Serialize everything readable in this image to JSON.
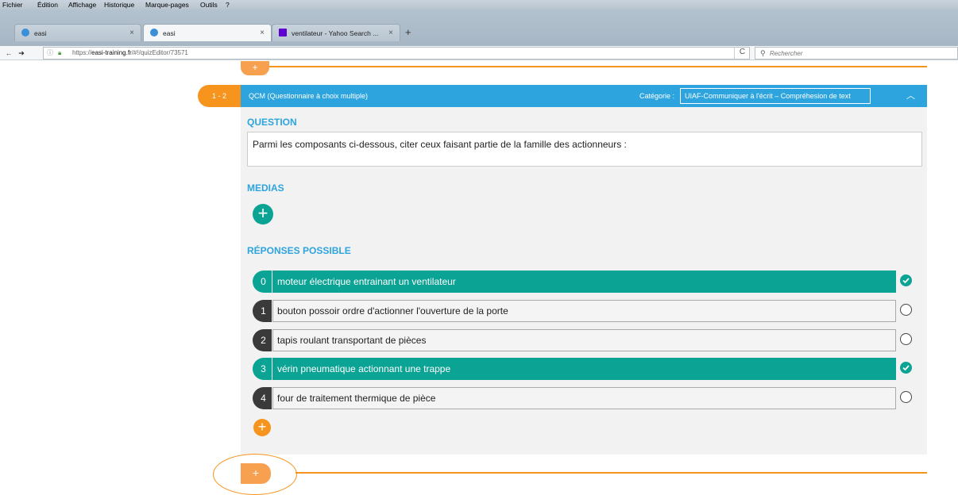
{
  "browser": {
    "menu": [
      "Fichier",
      "Édition",
      "Affichage",
      "Historique",
      "Marque-pages",
      "Outils",
      "?"
    ],
    "tabs": [
      {
        "title": "easi",
        "active": false,
        "favicon_color": "#3a8fd8"
      },
      {
        "title": "easi",
        "active": true,
        "favicon_color": "#3a8fd8"
      },
      {
        "title": "ventilateur - Yahoo Search ...",
        "active": false,
        "favicon_color": "#5f01d1"
      }
    ],
    "new_tab_label": "+",
    "url_prefix": "https://",
    "url_domain": "easi-training.fr",
    "url_path": "/#!/quizEditor/73571",
    "search_placeholder": "Rechercher",
    "reload_glyph": "C"
  },
  "question": {
    "number_label": "1 - 2",
    "type_label": "QCM (Questionnaire à choix multiple)",
    "category_label": "Catégorie :",
    "category_value": "UIAF-Communiquer à l'écrit – Compréhesion de text",
    "question_title": "QUESTION",
    "question_text": "Parmi les composants ci-dessous, citer ceux faisant partie de la famille des actionneurs :",
    "medias_title": "MEDIAS",
    "answers_title": "RÉPONSES POSSIBLE",
    "answers": [
      {
        "index": "0",
        "text": "moteur électrique entrainant un ventilateur",
        "correct": true
      },
      {
        "index": "1",
        "text": "bouton possoir ordre d'actionner l'ouverture de la porte",
        "correct": false
      },
      {
        "index": "2",
        "text": "tapis roulant transportant de pièces",
        "correct": false
      },
      {
        "index": "3",
        "text": "vérin pneumatique actionnant une trappe",
        "correct": true
      },
      {
        "index": "4",
        "text": "four de traitement thermique de pièce",
        "correct": false
      }
    ]
  },
  "colors": {
    "accent_blue": "#2da4de",
    "accent_orange": "#f7941d",
    "correct_green": "#0aa394",
    "panel_bg": "#f2f2f2"
  }
}
